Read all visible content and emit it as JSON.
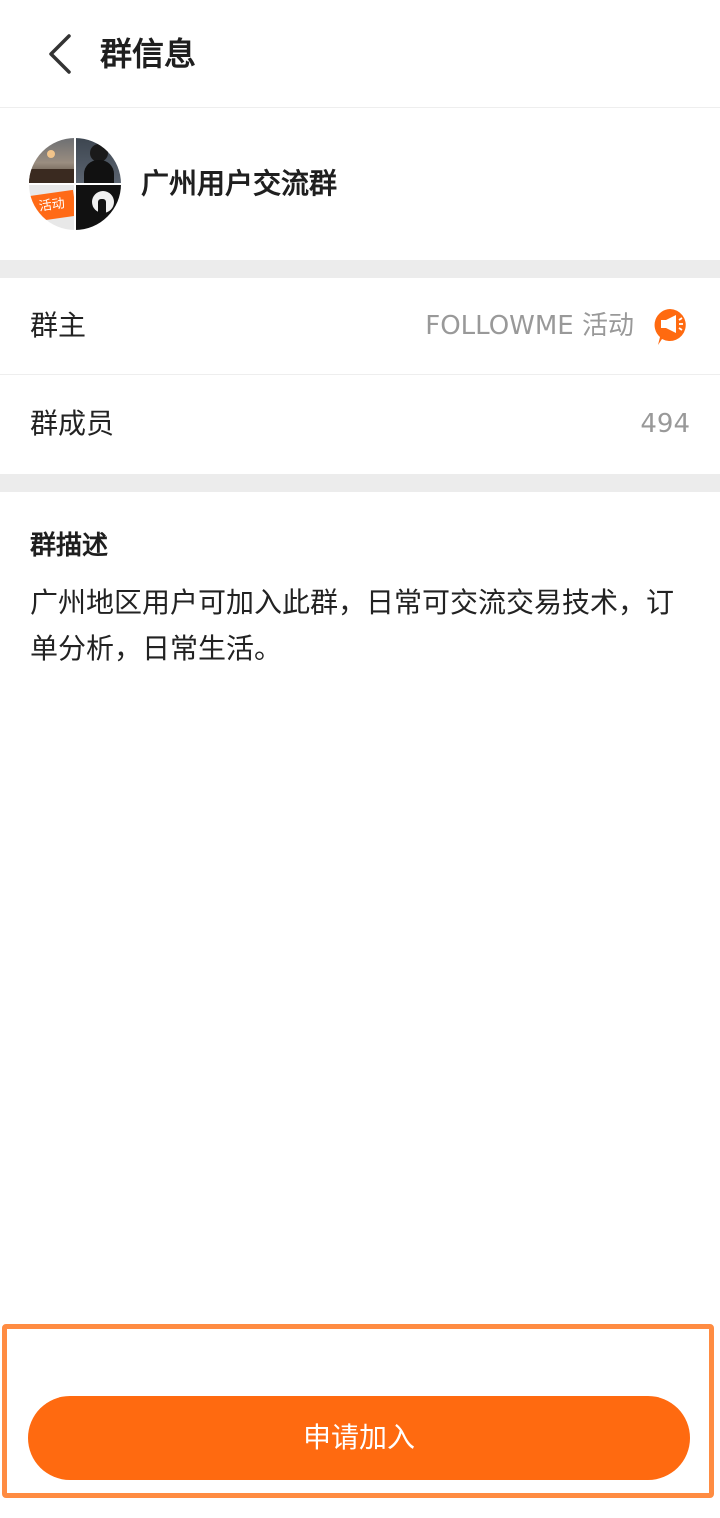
{
  "header": {
    "title": "群信息",
    "back_icon": "chevron-left-icon"
  },
  "group": {
    "name": "广州用户交流群",
    "avatar_badge_text": "活动"
  },
  "info": {
    "owner_label": "群主",
    "owner_value": "FOLLOWME 活动",
    "owner_icon": "megaphone-icon",
    "members_label": "群成员",
    "members_value": "494"
  },
  "description": {
    "title": "群描述",
    "text": "广州地区用户可加入此群，日常可交流交易技术，订单分析，日常生活。"
  },
  "actions": {
    "join_label": "申请加入"
  },
  "colors": {
    "accent": "#ff6a10",
    "highlight_border": "#ff8c42",
    "muted_text": "#999999",
    "divider": "#ececec"
  }
}
